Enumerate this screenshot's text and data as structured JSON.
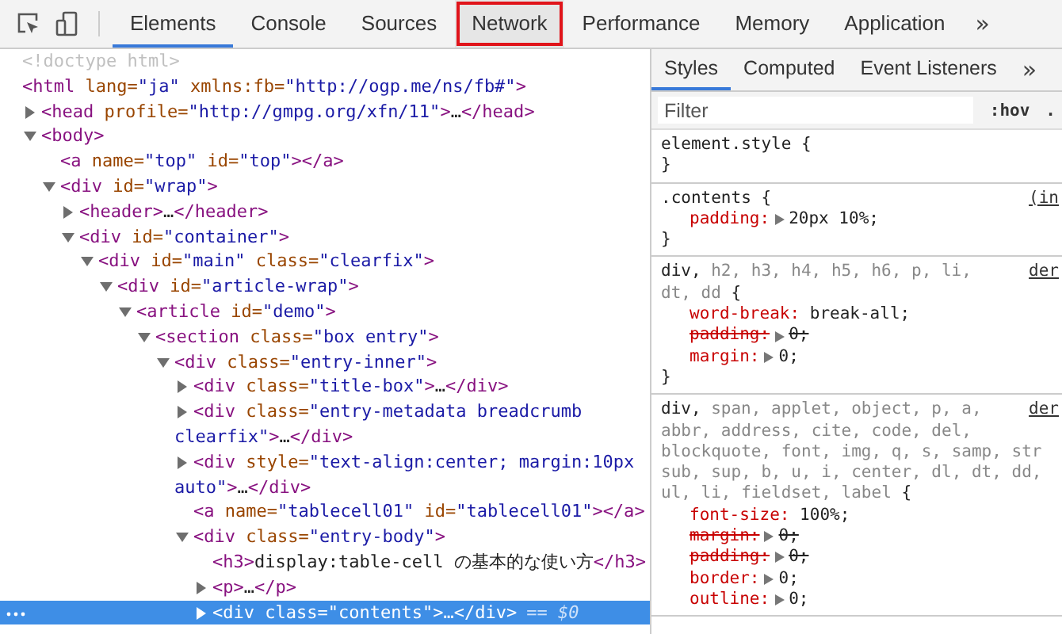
{
  "toolbar": {
    "tabs": [
      {
        "label": "Elements",
        "selected": true,
        "highlighted": false
      },
      {
        "label": "Console",
        "selected": false,
        "highlighted": false
      },
      {
        "label": "Sources",
        "selected": false,
        "highlighted": false
      },
      {
        "label": "Network",
        "selected": false,
        "highlighted": true
      },
      {
        "label": "Performance",
        "selected": false,
        "highlighted": false
      },
      {
        "label": "Memory",
        "selected": false,
        "highlighted": false
      },
      {
        "label": "Application",
        "selected": false,
        "highlighted": false
      }
    ],
    "more": "»"
  },
  "dom_tree": [
    {
      "kind": "doctype",
      "text": "<!doctype html>",
      "selected": false
    },
    {
      "kind": "element",
      "text": "<html lang=\"ja\" xmlns:fb=\"http://ogp.me/ns/fb#\">",
      "selected": false,
      "children": [
        {
          "kind": "element",
          "text": "<head profile=\"http://gmpg.org/xfn/11\">…</head>",
          "expanded": false,
          "selected": false
        },
        {
          "kind": "element",
          "text": "<body>",
          "expanded": true,
          "selected": false,
          "children": [
            {
              "kind": "element",
              "text": "<a name=\"top\" id=\"top\"></a>",
              "selected": false
            },
            {
              "kind": "element",
              "text": "<div id=\"wrap\">",
              "expanded": true,
              "selected": false,
              "children": [
                {
                  "kind": "element",
                  "text": "<header>…</header>",
                  "expanded": false,
                  "selected": false
                },
                {
                  "kind": "element",
                  "text": "<div id=\"container\">",
                  "expanded": true,
                  "selected": false,
                  "children": [
                    {
                      "kind": "element",
                      "text": "<div id=\"main\" class=\"clearfix\">",
                      "expanded": true,
                      "selected": false,
                      "children": [
                        {
                          "kind": "element",
                          "text": "<div id=\"article-wrap\">",
                          "expanded": true,
                          "selected": false,
                          "children": [
                            {
                              "kind": "element",
                              "text": "<article id=\"demo\">",
                              "expanded": true,
                              "selected": false,
                              "children": [
                                {
                                  "kind": "element",
                                  "text": "<section class=\"box entry\">",
                                  "expanded": true,
                                  "selected": false,
                                  "children": [
                                    {
                                      "kind": "element",
                                      "text": "<div class=\"entry-inner\">",
                                      "expanded": true,
                                      "selected": false,
                                      "children": [
                                        {
                                          "kind": "element",
                                          "text": "<div class=\"title-box\">…</div>",
                                          "expanded": false,
                                          "selected": false
                                        },
                                        {
                                          "kind": "element",
                                          "text": "<div class=\"entry-metadata breadcrumb clearfix\">…</div>",
                                          "expanded": false,
                                          "selected": false
                                        },
                                        {
                                          "kind": "element",
                                          "text": "<div style=\"text-align:center; margin:10px auto\">…</div>",
                                          "expanded": false,
                                          "selected": false
                                        },
                                        {
                                          "kind": "element",
                                          "text": "<a name=\"tablecell01\" id=\"tablecell01\"></a>",
                                          "selected": false
                                        },
                                        {
                                          "kind": "element",
                                          "text": "<div class=\"entry-body\">",
                                          "expanded": true,
                                          "selected": false,
                                          "children": [
                                            {
                                              "kind": "element",
                                              "text": "<h3>display:table-cell の基本的な使い方</h3>",
                                              "selected": false
                                            },
                                            {
                                              "kind": "element",
                                              "text": "<p>…</p>",
                                              "expanded": false,
                                              "selected": false
                                            },
                                            {
                                              "kind": "element",
                                              "text": "<div class=\"contents\">…</div>",
                                              "expanded": false,
                                              "selected": true,
                                              "note": "== $0"
                                            }
                                          ]
                                        }
                                      ]
                                    }
                                  ]
                                }
                              ]
                            }
                          ]
                        }
                      ]
                    }
                  ]
                }
              ]
            }
          ]
        }
      ]
    }
  ],
  "sidebar": {
    "tabs": [
      {
        "label": "Styles",
        "selected": true
      },
      {
        "label": "Computed",
        "selected": false
      },
      {
        "label": "Event Listeners",
        "selected": false
      }
    ],
    "more": "»",
    "filter": {
      "placeholder": "Filter"
    },
    "buttons": [
      ":hov",
      "."
    ],
    "rules": [
      {
        "selector_lines": [
          [
            {
              "text": "element.style",
              "matched": true
            },
            {
              "text": "{",
              "matched": true
            }
          ]
        ],
        "close": "}"
      },
      {
        "selector_lines": [
          [
            {
              "text": ".contents",
              "matched": true
            },
            {
              "text": "{",
              "matched": true
            }
          ]
        ],
        "source": "(in",
        "close": "}",
        "declarations": [
          {
            "name": "padding:",
            "value": "20px 10%;",
            "expandable": true,
            "overridden": false
          }
        ]
      },
      {
        "selector_lines": [
          [
            {
              "text": "div,",
              "matched": true
            },
            {
              "text": "h2, h3, h4, h5, h6, p, li,",
              "matched": false
            }
          ],
          [
            {
              "text": "dt, dd",
              "matched": false
            },
            {
              "text": "{",
              "matched": true
            }
          ]
        ],
        "source": "der",
        "close": "}",
        "declarations": [
          {
            "name": "word-break:",
            "value": "break-all;",
            "expandable": false,
            "overridden": false
          },
          {
            "name": "padding:",
            "value": "0;",
            "expandable": true,
            "overridden": true
          },
          {
            "name": "margin:",
            "value": "0;",
            "expandable": true,
            "overridden": false
          }
        ]
      },
      {
        "selector_lines": [
          [
            {
              "text": "div,",
              "matched": true
            },
            {
              "text": "span, applet, object, p, a,",
              "matched": false
            }
          ],
          [
            {
              "text": "abbr, address, cite, code, del,",
              "matched": false
            }
          ],
          [
            {
              "text": "blockquote, font, img, q, s, samp, str",
              "matched": false
            }
          ],
          [
            {
              "text": "sub, sup, b, u, i, center, dl, dt, dd,",
              "matched": false
            }
          ],
          [
            {
              "text": "ul, li, fieldset, label",
              "matched": false
            },
            {
              "text": "{",
              "matched": true
            }
          ]
        ],
        "source": "der",
        "declarations": [
          {
            "name": "font-size:",
            "value": "100%;",
            "expandable": false,
            "overridden": false
          },
          {
            "name": "margin:",
            "value": "0;",
            "expandable": true,
            "overridden": true
          },
          {
            "name": "padding:",
            "value": "0;",
            "expandable": true,
            "overridden": true
          },
          {
            "name": "border:",
            "value": "0;",
            "expandable": true,
            "overridden": false
          },
          {
            "name": "outline:",
            "value": "0;",
            "expandable": true,
            "overridden": false
          }
        ]
      }
    ]
  }
}
